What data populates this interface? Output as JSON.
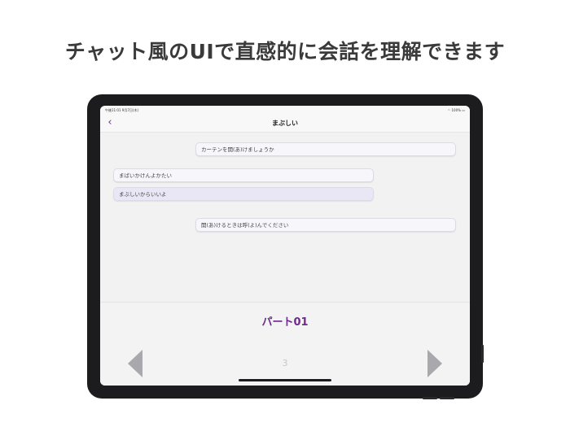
{
  "headline": "チャット風のUIで直感的に会話を理解できます",
  "status_bar": {
    "time_date": "午後11:01 9月7日(木)",
    "battery": "100%"
  },
  "nav": {
    "title": "まぶしい"
  },
  "messages": [
    {
      "text": "カーテンを開(あ)けましょうか",
      "side": "right"
    },
    {
      "text": "まばいかけんよかたい",
      "side": "left"
    },
    {
      "text": "まぶしいからいいよ",
      "side": "left",
      "highlighted": true
    },
    {
      "text": "開(あ)けるときは呼(よ)んでください",
      "side": "right"
    }
  ],
  "lesson": {
    "part_title": "パート01",
    "page_number": "3"
  },
  "colors": {
    "accent": "#6e2a8a",
    "arrow": "#a9a9ad"
  },
  "icons": {
    "back": "chevron-left-icon",
    "prev": "triangle-left-icon",
    "next": "triangle-right-icon"
  }
}
